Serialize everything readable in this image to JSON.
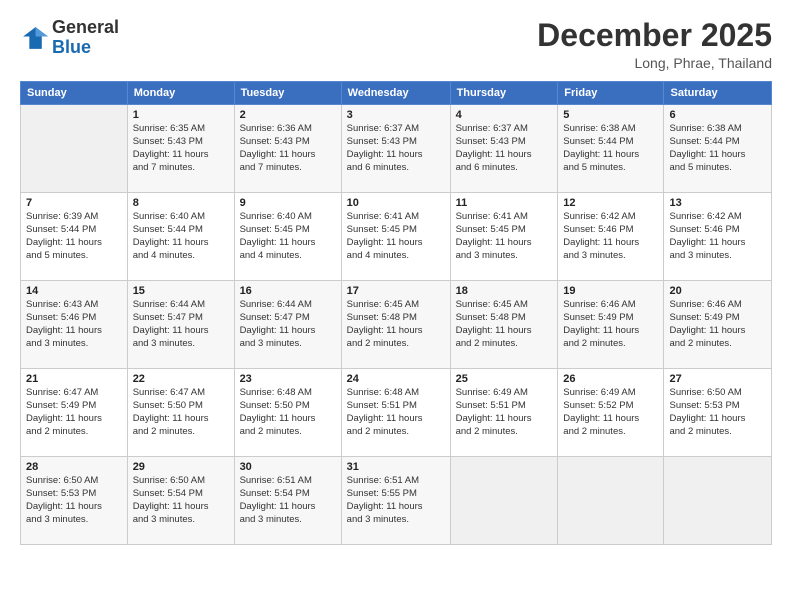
{
  "logo": {
    "general": "General",
    "blue": "Blue"
  },
  "header": {
    "month": "December 2025",
    "location": "Long, Phrae, Thailand"
  },
  "weekdays": [
    "Sunday",
    "Monday",
    "Tuesday",
    "Wednesday",
    "Thursday",
    "Friday",
    "Saturday"
  ],
  "weeks": [
    [
      {
        "day": "",
        "info": ""
      },
      {
        "day": "1",
        "info": "Sunrise: 6:35 AM\nSunset: 5:43 PM\nDaylight: 11 hours\nand 7 minutes."
      },
      {
        "day": "2",
        "info": "Sunrise: 6:36 AM\nSunset: 5:43 PM\nDaylight: 11 hours\nand 7 minutes."
      },
      {
        "day": "3",
        "info": "Sunrise: 6:37 AM\nSunset: 5:43 PM\nDaylight: 11 hours\nand 6 minutes."
      },
      {
        "day": "4",
        "info": "Sunrise: 6:37 AM\nSunset: 5:43 PM\nDaylight: 11 hours\nand 6 minutes."
      },
      {
        "day": "5",
        "info": "Sunrise: 6:38 AM\nSunset: 5:44 PM\nDaylight: 11 hours\nand 5 minutes."
      },
      {
        "day": "6",
        "info": "Sunrise: 6:38 AM\nSunset: 5:44 PM\nDaylight: 11 hours\nand 5 minutes."
      }
    ],
    [
      {
        "day": "7",
        "info": "Sunrise: 6:39 AM\nSunset: 5:44 PM\nDaylight: 11 hours\nand 5 minutes."
      },
      {
        "day": "8",
        "info": "Sunrise: 6:40 AM\nSunset: 5:44 PM\nDaylight: 11 hours\nand 4 minutes."
      },
      {
        "day": "9",
        "info": "Sunrise: 6:40 AM\nSunset: 5:45 PM\nDaylight: 11 hours\nand 4 minutes."
      },
      {
        "day": "10",
        "info": "Sunrise: 6:41 AM\nSunset: 5:45 PM\nDaylight: 11 hours\nand 4 minutes."
      },
      {
        "day": "11",
        "info": "Sunrise: 6:41 AM\nSunset: 5:45 PM\nDaylight: 11 hours\nand 3 minutes."
      },
      {
        "day": "12",
        "info": "Sunrise: 6:42 AM\nSunset: 5:46 PM\nDaylight: 11 hours\nand 3 minutes."
      },
      {
        "day": "13",
        "info": "Sunrise: 6:42 AM\nSunset: 5:46 PM\nDaylight: 11 hours\nand 3 minutes."
      }
    ],
    [
      {
        "day": "14",
        "info": "Sunrise: 6:43 AM\nSunset: 5:46 PM\nDaylight: 11 hours\nand 3 minutes."
      },
      {
        "day": "15",
        "info": "Sunrise: 6:44 AM\nSunset: 5:47 PM\nDaylight: 11 hours\nand 3 minutes."
      },
      {
        "day": "16",
        "info": "Sunrise: 6:44 AM\nSunset: 5:47 PM\nDaylight: 11 hours\nand 3 minutes."
      },
      {
        "day": "17",
        "info": "Sunrise: 6:45 AM\nSunset: 5:48 PM\nDaylight: 11 hours\nand 2 minutes."
      },
      {
        "day": "18",
        "info": "Sunrise: 6:45 AM\nSunset: 5:48 PM\nDaylight: 11 hours\nand 2 minutes."
      },
      {
        "day": "19",
        "info": "Sunrise: 6:46 AM\nSunset: 5:49 PM\nDaylight: 11 hours\nand 2 minutes."
      },
      {
        "day": "20",
        "info": "Sunrise: 6:46 AM\nSunset: 5:49 PM\nDaylight: 11 hours\nand 2 minutes."
      }
    ],
    [
      {
        "day": "21",
        "info": "Sunrise: 6:47 AM\nSunset: 5:49 PM\nDaylight: 11 hours\nand 2 minutes."
      },
      {
        "day": "22",
        "info": "Sunrise: 6:47 AM\nSunset: 5:50 PM\nDaylight: 11 hours\nand 2 minutes."
      },
      {
        "day": "23",
        "info": "Sunrise: 6:48 AM\nSunset: 5:50 PM\nDaylight: 11 hours\nand 2 minutes."
      },
      {
        "day": "24",
        "info": "Sunrise: 6:48 AM\nSunset: 5:51 PM\nDaylight: 11 hours\nand 2 minutes."
      },
      {
        "day": "25",
        "info": "Sunrise: 6:49 AM\nSunset: 5:51 PM\nDaylight: 11 hours\nand 2 minutes."
      },
      {
        "day": "26",
        "info": "Sunrise: 6:49 AM\nSunset: 5:52 PM\nDaylight: 11 hours\nand 2 minutes."
      },
      {
        "day": "27",
        "info": "Sunrise: 6:50 AM\nSunset: 5:53 PM\nDaylight: 11 hours\nand 2 minutes."
      }
    ],
    [
      {
        "day": "28",
        "info": "Sunrise: 6:50 AM\nSunset: 5:53 PM\nDaylight: 11 hours\nand 3 minutes."
      },
      {
        "day": "29",
        "info": "Sunrise: 6:50 AM\nSunset: 5:54 PM\nDaylight: 11 hours\nand 3 minutes."
      },
      {
        "day": "30",
        "info": "Sunrise: 6:51 AM\nSunset: 5:54 PM\nDaylight: 11 hours\nand 3 minutes."
      },
      {
        "day": "31",
        "info": "Sunrise: 6:51 AM\nSunset: 5:55 PM\nDaylight: 11 hours\nand 3 minutes."
      },
      {
        "day": "",
        "info": ""
      },
      {
        "day": "",
        "info": ""
      },
      {
        "day": "",
        "info": ""
      }
    ]
  ]
}
